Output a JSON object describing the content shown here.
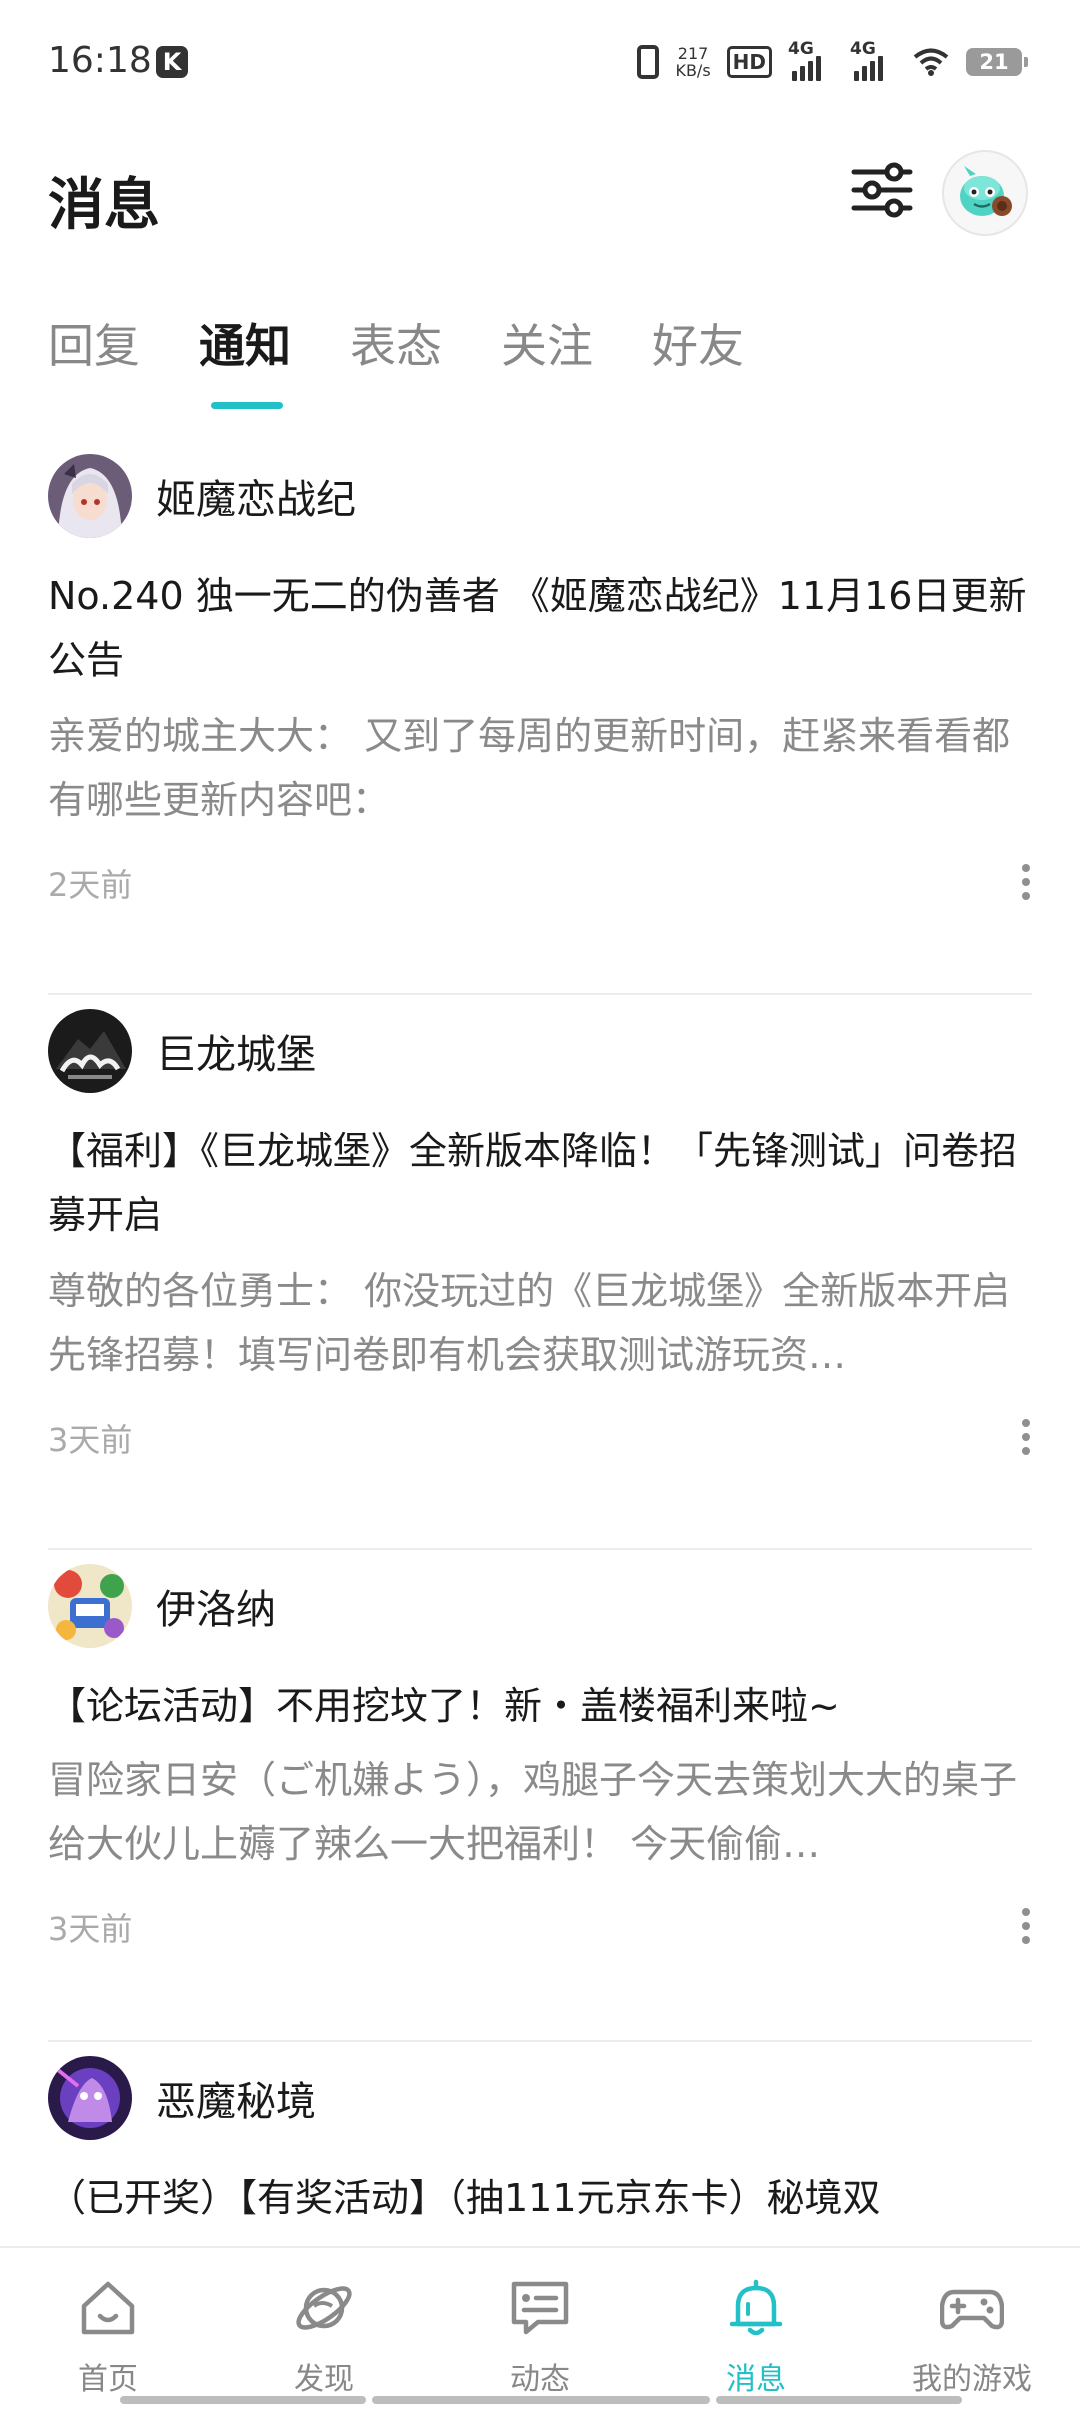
{
  "status_bar": {
    "time": "16:18",
    "app_badge": "K",
    "net_speed_value": "217",
    "net_speed_unit": "KB/s",
    "hd_label": "HD",
    "sim1_label": "4G",
    "sim2_label": "4G",
    "battery": "21",
    "icons": [
      "vibrate-icon",
      "hd-voice-icon",
      "signal-icon",
      "signal-icon",
      "wifi-icon",
      "battery-icon"
    ]
  },
  "header": {
    "title": "消息",
    "filter_icon": "sliders-icon",
    "avatar_icon": "user-avatar-icon"
  },
  "tabs": [
    {
      "label": "回复",
      "active": false
    },
    {
      "label": "通知",
      "active": true
    },
    {
      "label": "表态",
      "active": false
    },
    {
      "label": "关注",
      "active": false
    },
    {
      "label": "好友",
      "active": false
    }
  ],
  "notifications": [
    {
      "source": "姬魔恋战纪",
      "headline": "No.240 独一无二的伪善者 《姬魔恋战纪》11月16日更新公告",
      "excerpt": "亲爱的城主大大： 又到了每周的更新时间，赶紧来看看都有哪些更新内容吧：",
      "time": "2天前"
    },
    {
      "source": "巨龙城堡",
      "headline": "【福利】《巨龙城堡》全新版本降临！「先锋测试」问卷招募开启",
      "excerpt": "尊敬的各位勇士： 你没玩过的《巨龙城堡》全新版本开启先锋招募！填写问卷即有机会获取测试游玩资…",
      "time": "3天前"
    },
    {
      "source": "伊洛纳",
      "headline": "【论坛活动】不用挖坟了！新・盖楼福利来啦~",
      "excerpt": "冒险家日安（ご机嫌よう），鸡腿子今天去策划大大的桌子给大伙儿上薅了辣么一大把福利！ 今天偷偷…",
      "time": "3天前"
    },
    {
      "source": "恶魔秘境",
      "headline": "（已开奖）【有奖活动】（抽111元京东卡）秘境双",
      "excerpt": "",
      "time": ""
    }
  ],
  "bottom_nav": [
    {
      "label": "首页",
      "icon": "home-icon",
      "active": false
    },
    {
      "label": "发现",
      "icon": "planet-icon",
      "active": false
    },
    {
      "label": "动态",
      "icon": "chat-card-icon",
      "active": false
    },
    {
      "label": "消息",
      "icon": "bell-icon",
      "active": true
    },
    {
      "label": "我的游戏",
      "icon": "gamepad-icon",
      "active": false
    }
  ],
  "colors": {
    "accent": "#23c0c8",
    "secondary_text": "#8a8a8a",
    "time_text": "#aaaaaa"
  }
}
